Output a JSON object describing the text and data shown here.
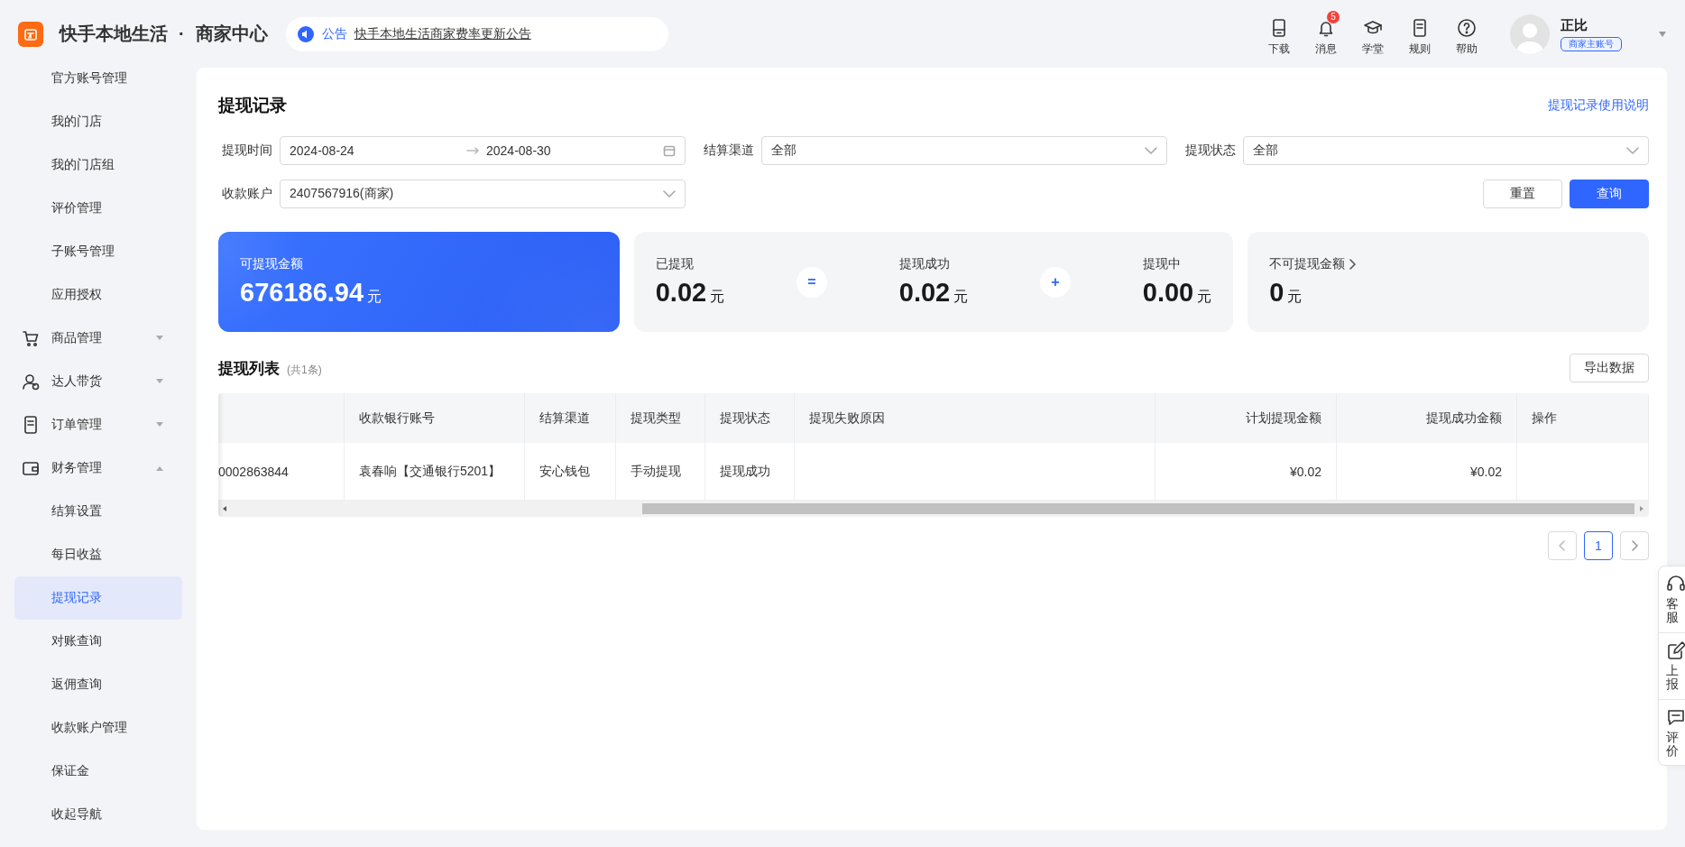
{
  "header": {
    "brand": "快手本地生活",
    "separator": "·",
    "subtitle": "商家中心",
    "notice": {
      "tag": "公告",
      "text": "快手本地生活商家费率更新公告"
    },
    "tools": [
      {
        "kind": "download",
        "label": "下载"
      },
      {
        "kind": "bell",
        "label": "消息",
        "badge": "5"
      },
      {
        "kind": "cap",
        "label": "学堂"
      },
      {
        "kind": "doc",
        "label": "规则"
      },
      {
        "kind": "help",
        "label": "帮助"
      }
    ],
    "user": {
      "name": "正比",
      "role": "商家主账号"
    }
  },
  "sidebar": {
    "items": [
      {
        "kind": "sub",
        "label": "官方账号管理",
        "selected": false
      },
      {
        "kind": "sub",
        "label": "我的门店",
        "selected": false
      },
      {
        "kind": "sub",
        "label": "我的门店组",
        "selected": false
      },
      {
        "kind": "sub",
        "label": "评价管理",
        "selected": false
      },
      {
        "kind": "sub",
        "label": "子账号管理",
        "selected": false
      },
      {
        "kind": "sub",
        "label": "应用授权",
        "selected": false
      },
      {
        "kind": "group",
        "label": "商品管理",
        "expanded": false
      },
      {
        "kind": "group",
        "label": "达人带货",
        "expanded": false
      },
      {
        "kind": "group",
        "label": "订单管理",
        "expanded": false
      },
      {
        "kind": "group",
        "label": "财务管理",
        "expanded": true,
        "children": [
          {
            "label": "结算设置",
            "selected": false
          },
          {
            "label": "每日收益",
            "selected": false
          },
          {
            "label": "提现记录",
            "selected": true
          },
          {
            "label": "对账查询",
            "selected": false
          },
          {
            "label": "返佣查询",
            "selected": false
          },
          {
            "label": "收款账户管理",
            "selected": false
          },
          {
            "label": "保证金",
            "selected": false
          }
        ]
      }
    ],
    "collapse": "收起导航"
  },
  "page": {
    "title": "提现记录",
    "help_link": "提现记录使用说明",
    "filters": [
      {
        "kind": "daterange",
        "label": "提现时间",
        "start": "2024-08-24",
        "end": "2024-08-30"
      },
      {
        "kind": "select",
        "label": "结算渠道",
        "value": "全部"
      },
      {
        "kind": "select",
        "label": "提现状态",
        "value": "全部"
      },
      {
        "kind": "select",
        "label": "收款账户",
        "value": "2407567916(商家)"
      }
    ],
    "buttons": [
      {
        "label": "重置",
        "primary": false
      },
      {
        "label": "查询",
        "primary": true
      }
    ],
    "cards": [
      {
        "kind": "primary",
        "items": [
          {
            "label": "可提现金额",
            "amount": "676186.94",
            "unit": "元"
          }
        ]
      },
      {
        "kind": "equation",
        "operators": [
          "=",
          "+"
        ],
        "items": [
          {
            "label": "已提现",
            "amount": "0.02",
            "unit": "元"
          },
          {
            "label": "提现成功",
            "amount": "0.02",
            "unit": "元"
          },
          {
            "label": "提现中",
            "amount": "0.00",
            "unit": "元"
          }
        ]
      },
      {
        "kind": "link",
        "items": [
          {
            "label": "不可提现金额",
            "amount": "0",
            "unit": "元"
          }
        ]
      }
    ]
  },
  "table": {
    "title": "提现列表",
    "count": "(共1条)",
    "export": "导出数据",
    "columns": [
      {
        "kind": "blank"
      },
      {
        "kind": "text",
        "label": "收款银行账号"
      },
      {
        "kind": "text",
        "label": "结算渠道"
      },
      {
        "kind": "text",
        "label": "提现类型"
      },
      {
        "kind": "text",
        "label": "提现状态"
      },
      {
        "kind": "text",
        "label": "提现失败原因"
      },
      {
        "kind": "amount",
        "label": "计划提现金额"
      },
      {
        "kind": "amount",
        "label": "提现成功金额"
      },
      {
        "kind": "text",
        "label": "操作"
      }
    ],
    "rows": [
      {
        "cells": [
          "0002863844",
          "袁春响【交通银行5201】",
          "安心钱包",
          "手动提现",
          "提现成功",
          null,
          "¥0.02",
          "¥0.02",
          null
        ]
      }
    ],
    "pages": [
      {
        "label": "1",
        "selected": true
      }
    ]
  },
  "float_tools": [
    {
      "kind": "headset",
      "label": "客服"
    },
    {
      "kind": "edit",
      "label": "上报"
    },
    {
      "kind": "chat",
      "label": "评价"
    }
  ]
}
